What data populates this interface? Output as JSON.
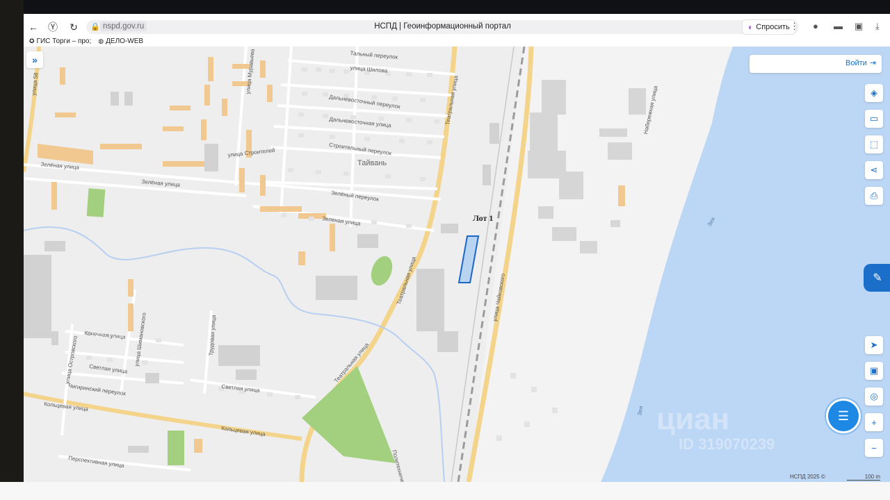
{
  "browser": {
    "domain": "nspd.gov.ru",
    "page_title": "НСПД | Геоинформационный портал",
    "ask_label": "Спросить",
    "bookmarks": [
      {
        "label": "ГИС Торги – про;"
      },
      {
        "label": "ДЕЛО-WEB"
      }
    ]
  },
  "map": {
    "login_label": "Войти",
    "lot_label": "Лот 1",
    "district_label": "Тайвань",
    "river_label": "Зея",
    "copyright": "НСПД 2025 ©",
    "scale": "100 m",
    "watermark": "циан",
    "watermark_id": "ID 319070239",
    "streets": {
      "s1": "улица 58",
      "s2": "Зелёная улица",
      "s3": "Зелёная улица",
      "s4": "улица Муравьева",
      "s5": "улица Строителей",
      "s6": "Зелёный переулок",
      "s7": "Зеленая улица",
      "s8": "улица Шилова",
      "s9": "Дальневосточный переулок",
      "s10": "Дальневосточная улица",
      "s11": "Строительный переулок",
      "s12": "Театральная улица",
      "s13": "Театральная улица",
      "s14": "Театральная улица",
      "s15": "улица Чайковского",
      "s16": "Набережная улица",
      "s17": "Конечная улица",
      "s18": "Светлая улица",
      "s19": "Чигиринский переулок",
      "s20": "Кольцевая улица",
      "s21": "Кольцевая улица",
      "s22": "Перспективная улица",
      "s23": "Трудовая улица",
      "s24": "Светлая улица",
      "s25": "улица Островского",
      "s26": "улица Шимановского",
      "s27": "Политехническая",
      "s28": "Зея",
      "s29": "Тальный переулок"
    }
  }
}
